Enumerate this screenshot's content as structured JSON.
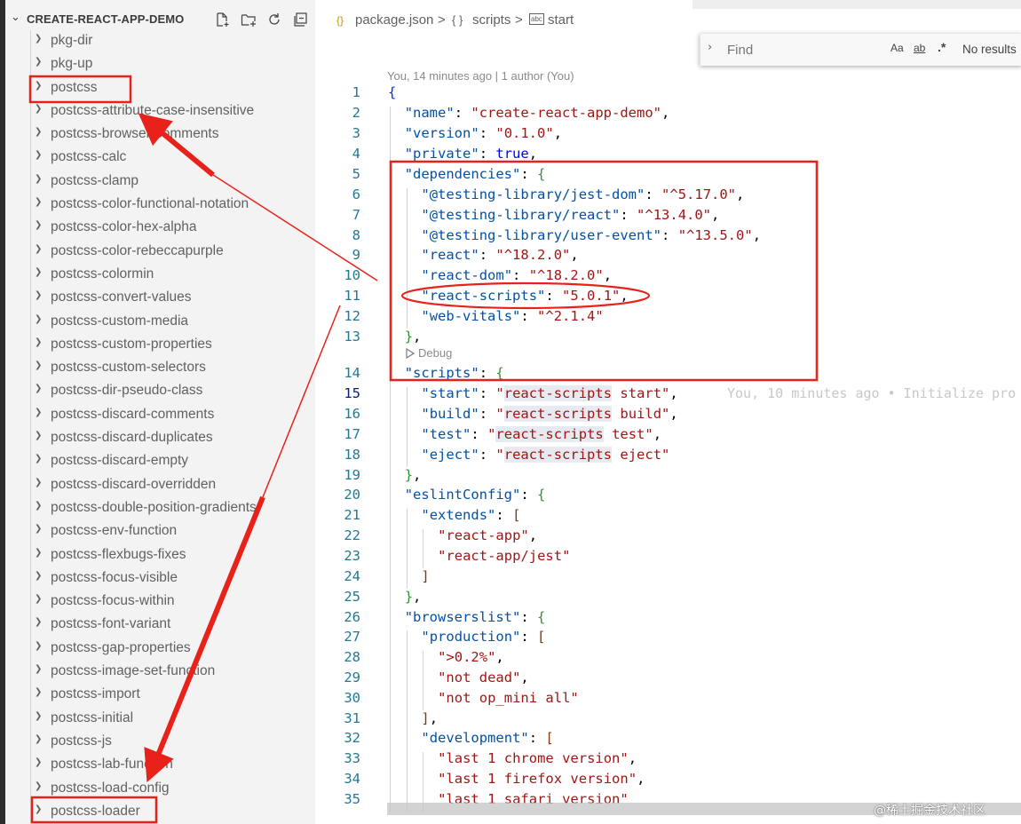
{
  "explorer": {
    "title": "CREATE-REACT-APP-DEMO",
    "actions": [
      "new-file-icon",
      "new-folder-icon",
      "refresh-icon",
      "collapse-all-icon"
    ],
    "items": [
      "pkg-dir",
      "pkg-up",
      "postcss",
      "postcss-attribute-case-insensitive",
      "postcss-browser-comments",
      "postcss-calc",
      "postcss-clamp",
      "postcss-color-functional-notation",
      "postcss-color-hex-alpha",
      "postcss-color-rebeccapurple",
      "postcss-colormin",
      "postcss-convert-values",
      "postcss-custom-media",
      "postcss-custom-properties",
      "postcss-custom-selectors",
      "postcss-dir-pseudo-class",
      "postcss-discard-comments",
      "postcss-discard-duplicates",
      "postcss-discard-empty",
      "postcss-discard-overridden",
      "postcss-double-position-gradients",
      "postcss-env-function",
      "postcss-flexbugs-fixes",
      "postcss-focus-visible",
      "postcss-focus-within",
      "postcss-font-variant",
      "postcss-gap-properties",
      "postcss-image-set-function",
      "postcss-import",
      "postcss-initial",
      "postcss-js",
      "postcss-lab-function",
      "postcss-load-config",
      "postcss-loader"
    ]
  },
  "breadcrumb": {
    "file_icon": "{}",
    "file": "package.json",
    "sep": ">",
    "scripts_icon": "{ }",
    "scripts": "scripts",
    "start_icon": "abc",
    "start": "start"
  },
  "find": {
    "placeholder": "Find",
    "match_case": "Aa",
    "whole_word": "ab",
    "regex": ".*",
    "results": "No results"
  },
  "blame_header": "You, 14 minutes ago | 1 author (You)",
  "codelens": "Debug",
  "inline_blame": "You, 10 minutes ago • Initialize pro",
  "code_lines": [
    "{",
    "\"name\": \"create-react-app-demo\",",
    "\"version\": \"0.1.0\",",
    "\"private\": true,",
    "\"dependencies\": {",
    "\"@testing-library/jest-dom\": \"^5.17.0\",",
    "\"@testing-library/react\": \"^13.4.0\",",
    "\"@testing-library/user-event\": \"^13.5.0\",",
    "\"react\": \"^18.2.0\",",
    "\"react-dom\": \"^18.2.0\",",
    "\"react-scripts\": \"5.0.1\",",
    "\"web-vitals\": \"^2.1.4\"",
    "},",
    "\"scripts\": {",
    "\"start\": \"react-scripts start\",",
    "\"build\": \"react-scripts build\",",
    "\"test\": \"react-scripts test\",",
    "\"eject\": \"react-scripts eject\"",
    "},",
    "\"eslintConfig\": {",
    "\"extends\": [",
    "\"react-app\",",
    "\"react-app/jest\"",
    "]",
    "},",
    "\"browserslist\": {",
    "\"production\": [",
    "\">0.2%\",",
    "\"not dead\",",
    "\"not op_mini all\"",
    "],",
    "\"development\": [",
    "\"last 1 chrome version\",",
    "\"last 1 firefox version\",",
    "\"last 1 safari version\""
  ],
  "watermark": "@稀土掘金技术社区",
  "colors": {
    "annotation_red": "#e8221b",
    "line_number": "#237893",
    "json_key": "#0451a5",
    "json_string": "#a31515",
    "json_keyword": "#0000ff"
  }
}
